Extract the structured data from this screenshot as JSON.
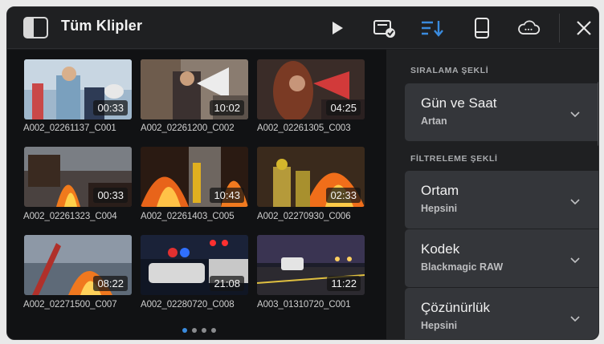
{
  "header": {
    "title": "Tüm Klipler"
  },
  "clips": [
    {
      "name": "A002_02261137_C001",
      "duration": "00:33"
    },
    {
      "name": "A002_02261200_C002",
      "duration": "10:02"
    },
    {
      "name": "A002_02261305_C003",
      "duration": "04:25"
    },
    {
      "name": "A002_02261323_C004",
      "duration": "00:33"
    },
    {
      "name": "A002_02261403_C005",
      "duration": "10:43"
    },
    {
      "name": "A002_02270930_C006",
      "duration": "02:33"
    },
    {
      "name": "A002_02271500_C007",
      "duration": "08:22"
    },
    {
      "name": "A002_02280720_C008",
      "duration": "21:08"
    },
    {
      "name": "A003_01310720_C001",
      "duration": "11:22"
    }
  ],
  "pagination": {
    "pages": 4,
    "current": 1
  },
  "sort": {
    "section_label": "SIRALAMA ŞEKLİ",
    "items": [
      {
        "label": "Gün ve Saat",
        "value": "Artan"
      }
    ]
  },
  "filter": {
    "section_label": "FİLTRELEME ŞEKLİ",
    "items": [
      {
        "label": "Ortam",
        "value": "Hepsini"
      },
      {
        "label": "Kodek",
        "value": "Blackmagic RAW"
      },
      {
        "label": "Çözünürlük",
        "value": "Hepsini"
      }
    ]
  },
  "colors": {
    "accent": "#3a8bde",
    "panel": "#1f2022",
    "card": "#34363a"
  }
}
